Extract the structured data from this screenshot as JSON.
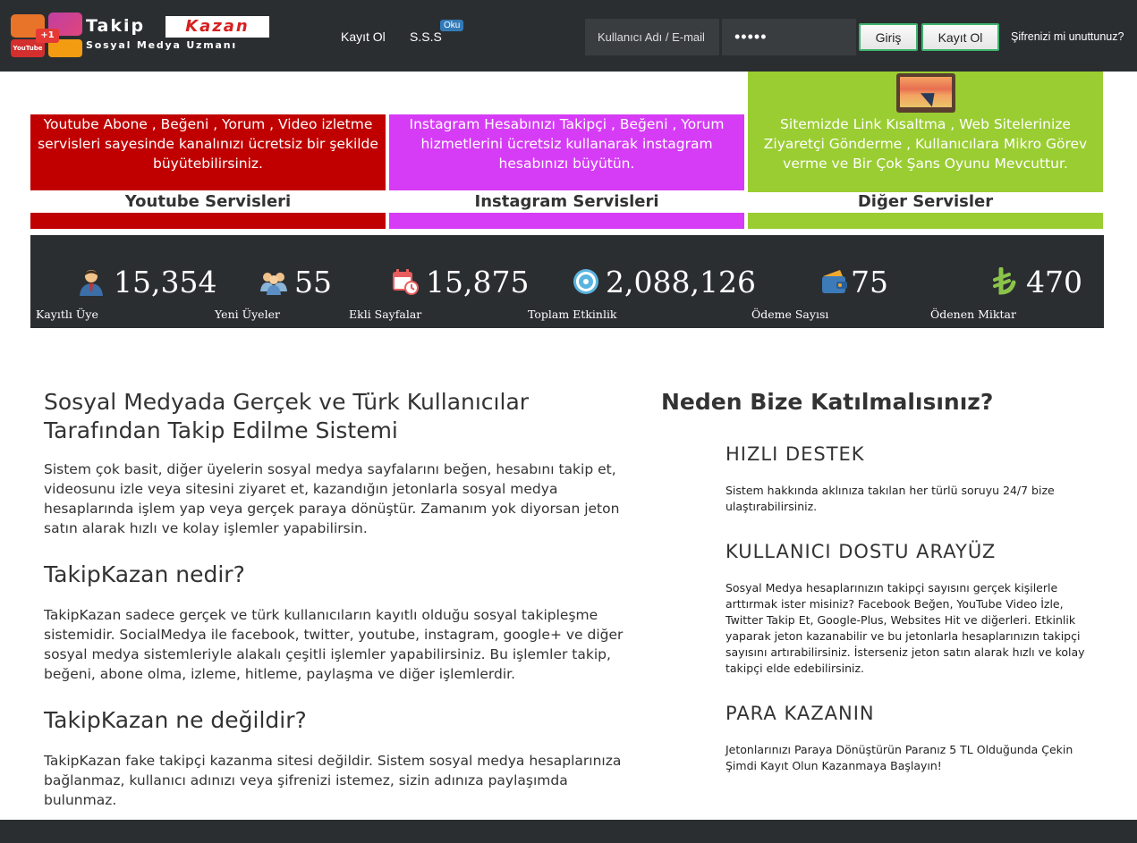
{
  "brand": {
    "name_part1": "Takip",
    "name_part2": "Kazan",
    "tagline": "Sosyal Medya Uzmanı",
    "yt_badge": "YouTube",
    "plus_badge": "+1"
  },
  "nav": {
    "register": "Kayıt Ol",
    "faq": "S.S.S",
    "faq_badge": "Oku"
  },
  "login": {
    "username_placeholder": "Kullanıcı Adı / E-mail",
    "password_value": "•••••",
    "login_button": "Giriş",
    "register_button": "Kayıt Ol",
    "forgot": "Şifrenizi mi unuttunuz?"
  },
  "colors": {
    "youtube": "#c00000",
    "instagram": "#d63cf5",
    "other": "#9acd32",
    "dark": "#2b2e31"
  },
  "services": [
    {
      "desc": "Youtube Abone , Beğeni , Yorum , Video izletme servisleri sayesinde kanalınızı ücretsiz bir şekilde büyütebilirsiniz.",
      "title": "Youtube Servisleri"
    },
    {
      "desc": "Instagram Hesabınızı Takipçi , Beğeni , Yorum hizmetlerini ücretsiz kullanarak instagram hesabınızı büyütün.",
      "title": "Instagram Servisleri"
    },
    {
      "desc": "Sitemizde Link Kısaltma , Web Sitelerinize Ziyaretçi Gönderme , Kullanıcılara Mikro Görev verme ve Bir Çok Şans Oyunu Mevcuttur.",
      "title": "Diğer Servisler",
      "icon": "monitor-cursor-icon"
    }
  ],
  "stats": [
    {
      "value": "15,354",
      "label": "Kayıtlı Üye",
      "icon": "user-icon"
    },
    {
      "value": "55",
      "label": "Yeni Üyeler",
      "icon": "users-group-icon"
    },
    {
      "value": "15,875",
      "label": "Ekli Sayfalar",
      "icon": "calendar-clock-icon"
    },
    {
      "value": "2,088,126",
      "label": "Toplam Etkinlik",
      "icon": "gear-icon"
    },
    {
      "value": "75",
      "label": "Ödeme Sayısı",
      "icon": "wallet-icon"
    },
    {
      "value": "470",
      "label": "Ödenen Miktar",
      "icon": "lira-icon"
    }
  ],
  "left": {
    "heading": "Sosyal Medyada Gerçek ve Türk Kullanıcılar Tarafından Takip Edilme Sistemi",
    "intro": "Sistem çok basit, diğer üyelerin sosyal medya sayfalarını beğen, hesabını takip et, videosunu izle veya sitesini ziyaret et, kazandığın jetonlarla sosyal medya hesaplarında işlem yap veya gerçek paraya dönüştür. Zamanım yok diyorsan jeton satın alarak hızlı ve kolay işlemler yapabilirsin.",
    "what_heading": "TakipKazan nedir?",
    "what_text": "TakipKazan sadece gerçek ve türk kullanıcıların kayıtlı olduğu sosyal takipleşme sistemidir. SocialMedya ile facebook, twitter, youtube, instagram, google+ ve diğer sosyal medya sistemleriyle alakalı çeşitli işlemler yapabilirsiniz. Bu işlemler takip, beğeni, abone olma, izleme, hitleme, paylaşma ve diğer işlemlerdir.",
    "not_heading": "TakipKazan ne değildir?",
    "not_text": "TakipKazan fake takipçi kazanma sitesi değildir. Sistem sosyal medya hesaplarınıza bağlanmaz, kullanıcı adınızı veya şifrenizi istemez, sizin adınıza paylaşımda bulunmaz."
  },
  "right": {
    "heading": "Neden Bize Katılmalısınız?",
    "items": [
      {
        "title": "HIZLI DESTEK",
        "text": "Sistem hakkında aklınıza takılan her türlü soruyu 24/7 bize ulaştırabilirsiniz."
      },
      {
        "title": "KULLANICI DOSTU ARAYÜZ",
        "text": "Sosyal Medya hesaplarınızın takipçi sayısını gerçek kişilerle arttırmak ister misiniz? Facebook Beğen, YouTube Video İzle, Twitter Takip Et, Google-Plus, Websites Hit ve diğerleri. Etkinlik yaparak jeton kazanabilir ve bu jetonlarla hesaplarınızın takipçi sayısını artırabilirsiniz. İsterseniz jeton satın alarak hızlı ve kolay takipçi elde edebilirsiniz."
      },
      {
        "title": "PARA KAZANIN",
        "text": "Jetonlarınızı Paraya Dönüştürün Paranız 5 TL Olduğunda Çekin Şimdi Kayıt Olun Kazanmaya Başlayın!"
      }
    ]
  }
}
